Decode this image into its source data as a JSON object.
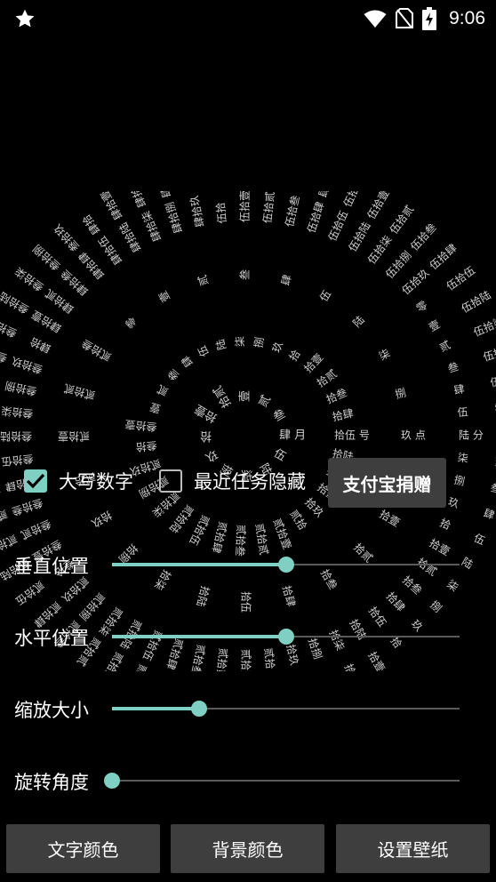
{
  "status_bar": {
    "time": "9:06",
    "icons": [
      "star-icon",
      "wifi-icon",
      "no-sim-icon",
      "battery-charging-icon"
    ]
  },
  "clock_art": {
    "color": "#cfcfcf",
    "rings": [
      {
        "name": "month",
        "count": 12,
        "suffix": "月"
      },
      {
        "name": "day",
        "count": 31,
        "suffix": "号"
      },
      {
        "name": "hour",
        "count": 24,
        "suffix": "点"
      },
      {
        "name": "minute",
        "count": 60,
        "suffix": "分"
      },
      {
        "name": "second",
        "count": 60,
        "suffix": "秒"
      }
    ],
    "current": {
      "month": 4,
      "day": 15,
      "hour": 9,
      "minute": 6,
      "second": 1
    }
  },
  "options": {
    "uppercase_label": "大写数字",
    "uppercase_checked": true,
    "hide_recent_label": "最近任务隐藏",
    "hide_recent_checked": false,
    "donate_label": "支付宝捐赠"
  },
  "sliders": [
    {
      "label": "垂直位置",
      "value": 0.5
    },
    {
      "label": "水平位置",
      "value": 0.5
    },
    {
      "label": "缩放大小",
      "value": 0.25
    },
    {
      "label": "旋转角度",
      "value": 0.0
    }
  ],
  "buttons": {
    "text_color": "文字颜色",
    "background_color": "背景颜色",
    "set_wallpaper": "设置壁纸"
  },
  "colors": {
    "accent": "#7fcfc2",
    "button_bg": "#3e3e3e",
    "background": "#000000"
  }
}
